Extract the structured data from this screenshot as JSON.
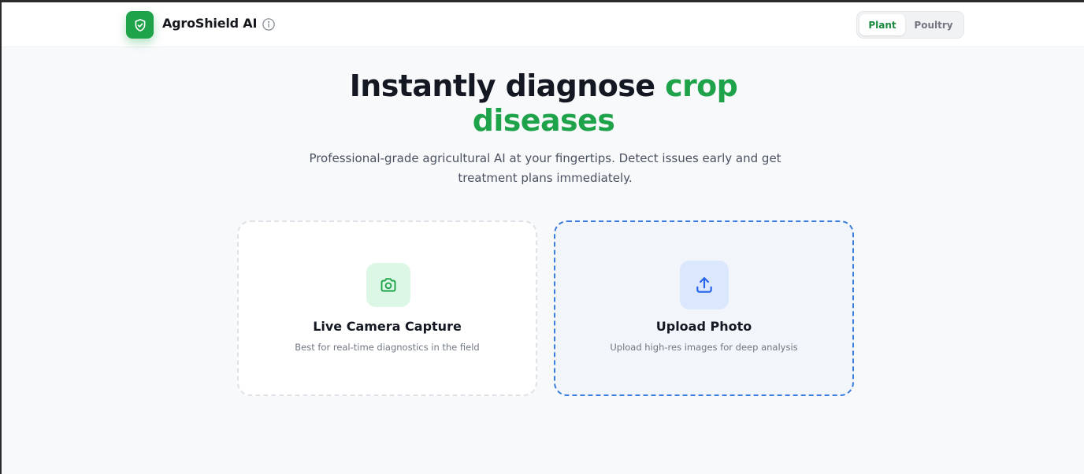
{
  "header": {
    "brand": "AgroShield AI",
    "logo_icon": "shield-check-icon",
    "info_icon": "info-icon",
    "mode_toggle": {
      "options": [
        "Plant",
        "Poultry"
      ],
      "selected": "Plant"
    }
  },
  "hero": {
    "title_prefix": "Instantly diagnose ",
    "title_accent": "crop diseases",
    "subtitle": "Professional-grade agricultural AI at your fingertips. Detect issues early and get treatment plans immediately."
  },
  "options": [
    {
      "title": "Live Camera Capture",
      "description": "Best for real-time diagnostics in the field",
      "icon": "camera-icon"
    },
    {
      "title": "Upload Photo",
      "description": "Upload high-res images for deep analysis",
      "icon": "upload-icon"
    }
  ],
  "colors": {
    "brand_green": "#1ea34a",
    "upload_blue": "#3b7ddd",
    "heading": "#141822",
    "background": "#f8f9fb"
  }
}
